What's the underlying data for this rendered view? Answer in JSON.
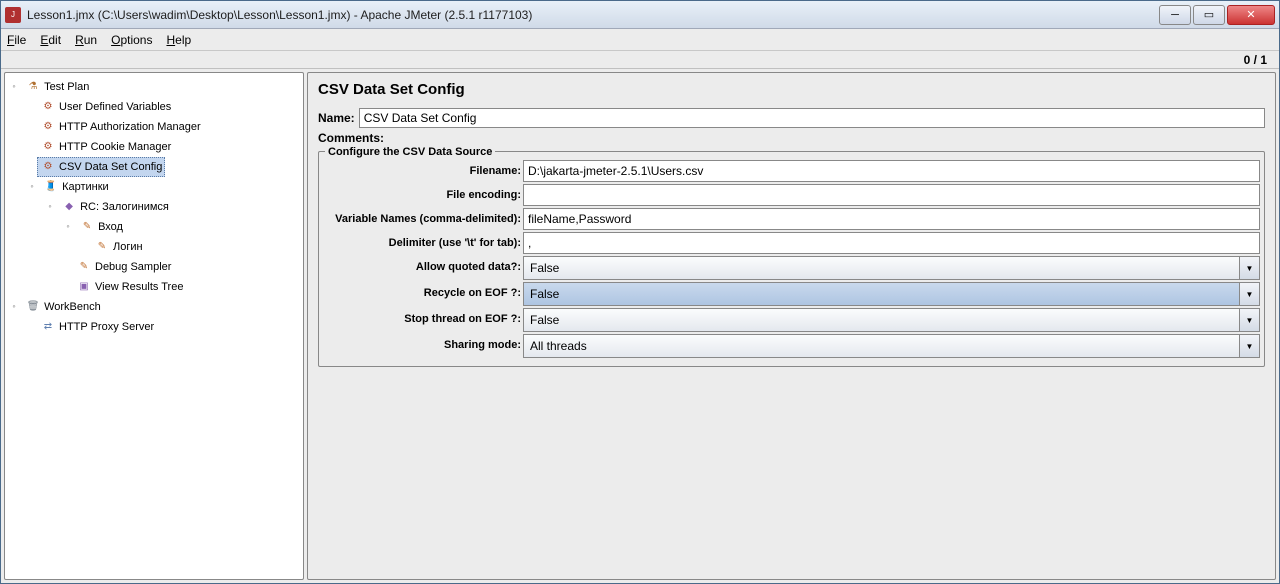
{
  "titlebar": {
    "text": "Lesson1.jmx (C:\\Users\\wadim\\Desktop\\Lesson\\Lesson1.jmx) - Apache JMeter (2.5.1 r1177103)"
  },
  "win_controls": {
    "min": "─",
    "max": "▭",
    "close": "✕"
  },
  "menu": {
    "file": "File",
    "edit": "Edit",
    "run": "Run",
    "options": "Options",
    "help": "Help"
  },
  "counter": "0 / 1",
  "tree": {
    "test_plan": "Test Plan",
    "user_vars": "User Defined Variables",
    "http_auth": "HTTP Authorization Manager",
    "http_cookie": "HTTP Cookie Manager",
    "csv": "CSV Data Set Config",
    "pictures": "Картинки",
    "rc_login": "RC: Залогинимся",
    "vhod": "Вход",
    "login": "Логин",
    "debug": "Debug Sampler",
    "results": "View Results Tree",
    "workbench": "WorkBench",
    "proxy": "HTTP Proxy Server"
  },
  "config": {
    "title": "CSV Data Set Config",
    "name_label": "Name:",
    "name_value": "CSV Data Set Config",
    "comments_label": "Comments:",
    "legend": "Configure the CSV Data Source",
    "filename_label": "Filename:",
    "filename_value": "D:\\jakarta-jmeter-2.5.1\\Users.csv",
    "encoding_label": "File encoding:",
    "encoding_value": "",
    "vars_label": "Variable Names (comma-delimited):",
    "vars_value": "fileName,Password",
    "delim_label": "Delimiter (use '\\t' for tab):",
    "delim_value": ",",
    "quoted_label": "Allow quoted data?:",
    "quoted_value": "False",
    "recycle_label": "Recycle on EOF ?:",
    "recycle_value": "False",
    "stop_label": "Stop thread on EOF ?:",
    "stop_value": "False",
    "sharing_label": "Sharing mode:",
    "sharing_value": "All threads"
  }
}
